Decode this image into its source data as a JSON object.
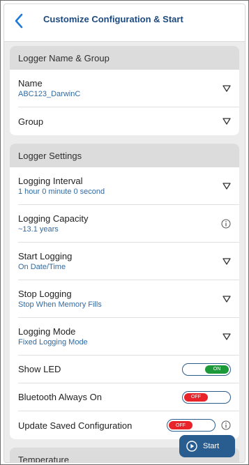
{
  "header": {
    "title": "Customize Configuration & Start"
  },
  "sections": {
    "name_group": {
      "title": "Logger Name & Group",
      "name": {
        "label": "Name",
        "value": "ABC123_DarwinC"
      },
      "group": {
        "label": "Group"
      }
    },
    "settings": {
      "title": "Logger Settings",
      "interval": {
        "label": "Logging Interval",
        "value": "1 hour 0 minute 0 second"
      },
      "capacity": {
        "label": "Logging Capacity",
        "value": "~13.1 years"
      },
      "start": {
        "label": "Start Logging",
        "value": "On Date/Time"
      },
      "stop": {
        "label": "Stop Logging",
        "value": "Stop When Memory Fills"
      },
      "mode": {
        "label": "Logging Mode",
        "value": "Fixed Logging Mode"
      },
      "led": {
        "label": "Show LED",
        "state": "ON"
      },
      "bluetooth": {
        "label": "Bluetooth Always On",
        "state": "OFF"
      },
      "update": {
        "label": "Update Saved Configuration",
        "state": "OFF"
      }
    },
    "temperature": {
      "title": "Temperature"
    }
  },
  "start_button": {
    "label": "Start"
  },
  "icons": {
    "back": "chevron-left-icon",
    "dropdown": "chevron-down-icon",
    "info": "info-icon",
    "play": "play-circle-icon"
  },
  "colors": {
    "accent": "#1d4a7e",
    "value_text": "#2f6aa3",
    "toggle_on": "#1c9a3a",
    "toggle_off": "#e8242a",
    "button": "#2a5d8f"
  }
}
